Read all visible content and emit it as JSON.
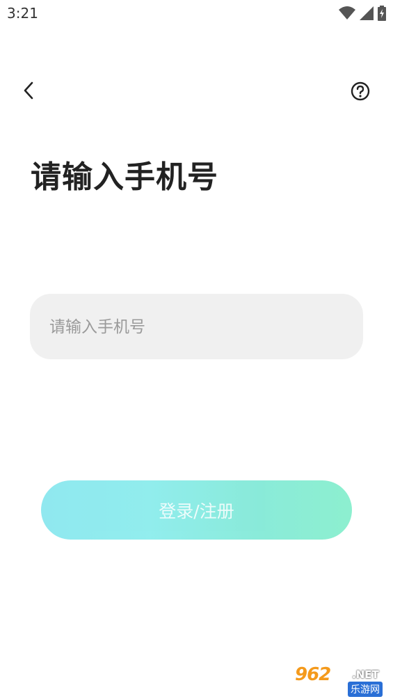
{
  "status_bar": {
    "time": "3:21",
    "icons": [
      "wifi-icon",
      "signal-icon",
      "battery-icon"
    ]
  },
  "nav": {
    "back_icon": "chevron-left-icon",
    "help_icon": "question-circle-icon"
  },
  "page": {
    "title": "请输入手机号"
  },
  "phone_input": {
    "placeholder": "请输入手机号",
    "value": ""
  },
  "login_button": {
    "label": "登录/注册"
  },
  "watermark": {
    "main": "962",
    "net": ".NET",
    "sub": "乐游网"
  },
  "colors": {
    "input_bg": "#f0f0f0",
    "button_gradient_start": "#86e6ee",
    "button_gradient_end": "#83eecb",
    "title": "#222222"
  }
}
